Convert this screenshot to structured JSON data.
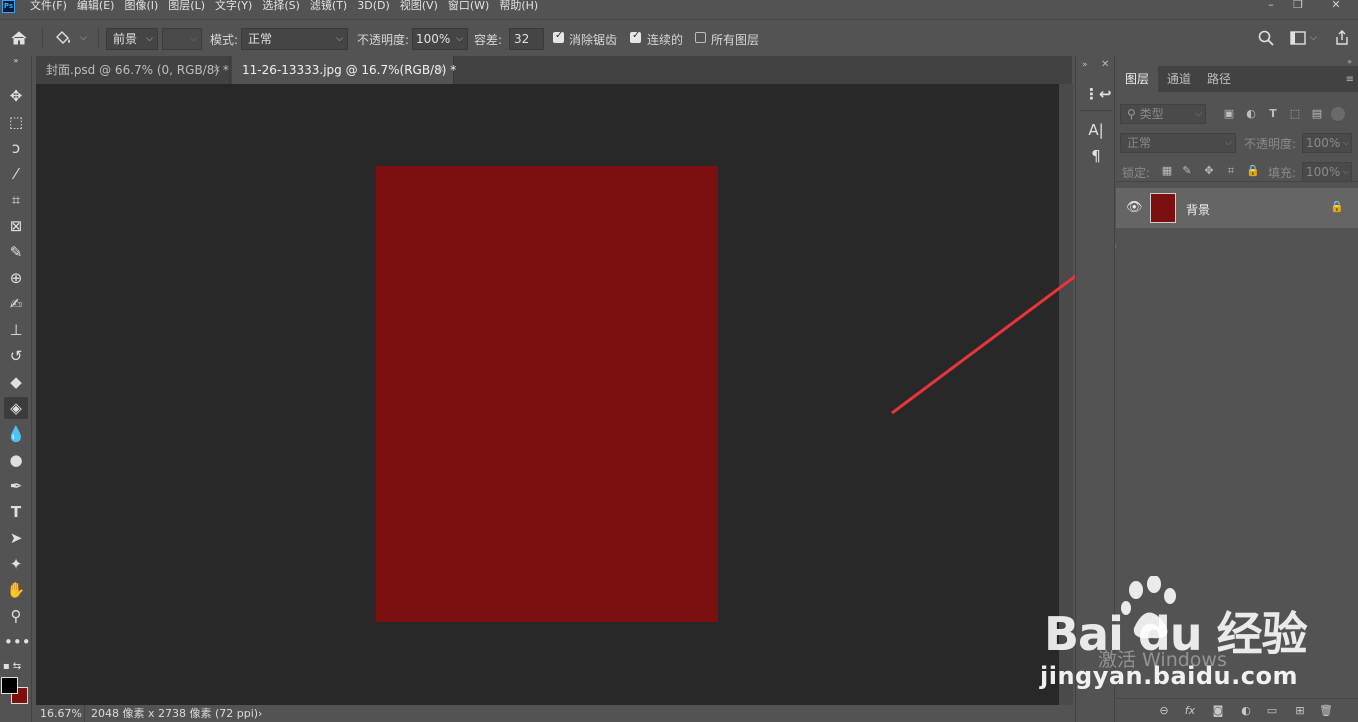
{
  "app": {
    "logo_text": "Ps"
  },
  "menu": [
    "文件(F)",
    "编辑(E)",
    "图像(I)",
    "图层(L)",
    "文字(Y)",
    "选择(S)",
    "滤镜(T)",
    "3D(D)",
    "视图(V)",
    "窗口(W)",
    "帮助(H)"
  ],
  "window_controls": {
    "minimize": "–",
    "restore": "❐",
    "close": "✕"
  },
  "options_bar": {
    "fill_source": "前景",
    "mode_label": "模式:",
    "mode_value": "正常",
    "opacity_label": "不透明度:",
    "opacity_value": "100%",
    "tolerance_label": "容差:",
    "tolerance_value": "32",
    "antialias_label": "消除锯齿",
    "antialias_checked": true,
    "contiguous_label": "连续的",
    "contiguous_checked": true,
    "all_layers_label": "所有图层",
    "all_layers_checked": false
  },
  "tabs": [
    {
      "label": "封面.psd @ 66.7% (0, RGB/8) *",
      "close": "×",
      "active": false
    },
    {
      "label": "11-26-13333.jpg @ 16.7%(RGB/8) *",
      "close": "×",
      "active": true
    }
  ],
  "status": {
    "zoom": "16.67%",
    "doc_info": "2048 像素 x 2738 像素 (72 ppi)",
    "arrow": "›"
  },
  "layers_panel": {
    "tabs": [
      "图层",
      "通道",
      "路径"
    ],
    "filter_placeholder": "类型",
    "blend_mode": "正常",
    "opacity_label": "不透明度:",
    "opacity_value": "100%",
    "lock_label": "锁定:",
    "fill_label": "填充:",
    "fill_value": "100%",
    "layers": [
      {
        "name": "背景",
        "locked": true,
        "visible": true
      }
    ]
  },
  "colors": {
    "document_fill": "#7c1010",
    "annotation_arrow": "#e8353a",
    "canvas_bg": "#282828"
  },
  "watermark": {
    "brand": "Bai du 经验",
    "url": "jingyan.baidu.com",
    "activate": "激活 Windows"
  }
}
